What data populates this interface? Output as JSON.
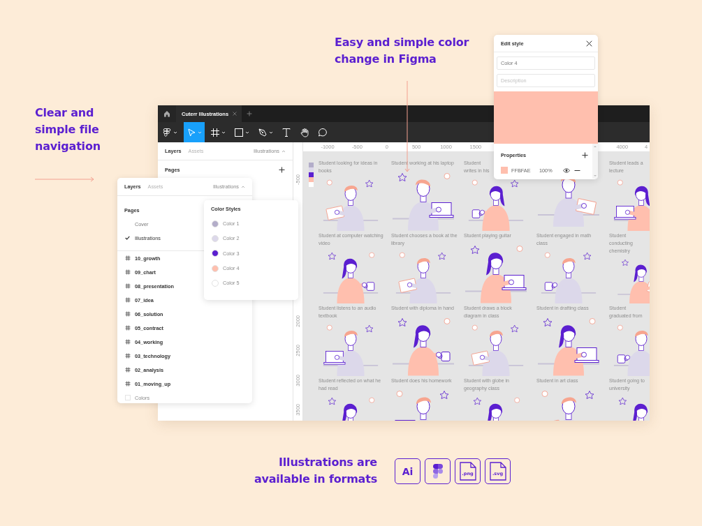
{
  "navigation_caption": "Clear and simple file navigation",
  "color_caption": "Easy and simple color change in Figma",
  "formats_caption": "Illustrations are available in formats",
  "formats": [
    {
      "kind": "ai",
      "label": "Ai"
    },
    {
      "kind": "figma"
    },
    {
      "kind": "file",
      "label": ".png"
    },
    {
      "kind": "file",
      "label": ".svg"
    }
  ],
  "window": {
    "tabs": [
      {
        "title": "Cuterr Illustrations",
        "selected": true
      }
    ],
    "tools": [
      {
        "kind": "menu",
        "selected": false,
        "dropdown": true
      },
      {
        "kind": "move",
        "selected": true,
        "dropdown": true
      },
      {
        "kind": "frame",
        "selected": false,
        "dropdown": true
      },
      {
        "kind": "rectangle",
        "selected": false,
        "dropdown": true
      },
      {
        "kind": "pen",
        "selected": false,
        "dropdown": true
      },
      {
        "kind": "text",
        "selected": false,
        "dropdown": false
      },
      {
        "kind": "hand",
        "selected": false,
        "dropdown": false
      },
      {
        "kind": "comment",
        "selected": false,
        "dropdown": false
      }
    ],
    "layers_panel": {
      "tabs": [
        {
          "label": "Layers",
          "selected": true
        },
        {
          "label": "Assets",
          "selected": false
        }
      ],
      "page_menu": "Illustrations",
      "pages_heading": "Pages"
    },
    "top_ruler": {
      "left_labels": [
        "-1000",
        "-500",
        "0",
        "500",
        "1000",
        "1500"
      ],
      "right_labels": [
        "4000",
        "4"
      ]
    },
    "left_ruler": {
      "upper_labels": [
        "-500"
      ],
      "lower_labels": [
        "2000",
        "2500",
        "3000",
        "3500"
      ]
    },
    "canvas": {
      "cells": [
        {
          "kind": "illustration",
          "caption": "Student looking for ideas in books"
        },
        {
          "kind": "illustration",
          "caption": "Student working at his laptop"
        },
        {
          "kind": "illustration",
          "caption": "Student writes in his"
        },
        {
          "kind": "illustration"
        },
        {
          "kind": "illustration",
          "caption": "Student leads a lecture"
        },
        {
          "kind": "illustration",
          "caption": "Student at computer watching video"
        },
        {
          "kind": "illustration",
          "caption": "Student chooses a book at the library"
        },
        {
          "kind": "illustration",
          "caption": "Student playing guitar"
        },
        {
          "kind": "illustration",
          "caption": "Student engaged in math class"
        },
        {
          "kind": "illustration",
          "caption": "Student conducting chemistry"
        },
        {
          "kind": "illustration",
          "caption": "Student listens to an audio textbook"
        },
        {
          "kind": "illustration",
          "caption": "Student with diploma in hand"
        },
        {
          "kind": "illustration",
          "caption": "Student draws a block diagram in class"
        },
        {
          "kind": "illustration",
          "caption": "Student in drafting class"
        },
        {
          "kind": "illustration",
          "caption": "Student graduated from"
        },
        {
          "kind": "illustration",
          "caption": "Student reflected on what he had read"
        },
        {
          "kind": "illustration",
          "caption": "Student does his homework"
        },
        {
          "kind": "illustration",
          "caption": "Student with globe in geography class"
        },
        {
          "kind": "illustration",
          "caption": "Student in art class"
        },
        {
          "kind": "illustration",
          "caption": "Student going to university"
        }
      ]
    }
  },
  "floating_layers_panel": {
    "tabs": [
      {
        "label": "Layers",
        "selected": true
      },
      {
        "label": "Assets",
        "selected": false
      }
    ],
    "page_menu": "Illustrations",
    "pages_heading": "Pages",
    "pages": [
      {
        "name": "Cover",
        "selected": false
      },
      {
        "name": "Illustrations",
        "selected": true
      }
    ],
    "layers": [
      {
        "kind": "frame",
        "name": "10_growth"
      },
      {
        "kind": "frame",
        "name": "09_chart"
      },
      {
        "kind": "frame",
        "name": "08_presentation"
      },
      {
        "kind": "frame",
        "name": "07_idea"
      },
      {
        "kind": "frame",
        "name": "06_solution"
      },
      {
        "kind": "frame",
        "name": "05_contract"
      },
      {
        "kind": "frame",
        "name": "04_working"
      },
      {
        "kind": "frame",
        "name": "03_technology"
      },
      {
        "kind": "frame",
        "name": "02_analysis"
      },
      {
        "kind": "frame",
        "name": "01_moving_up"
      },
      {
        "kind": "group",
        "name": "Colors"
      }
    ]
  },
  "color_styles": {
    "title": "Color Styles",
    "items": [
      {
        "name": "Color 1",
        "color": "#b3adc9"
      },
      {
        "name": "Color 2",
        "color": "#dcd8ea"
      },
      {
        "name": "Color 3",
        "color": "#5b1fd0"
      },
      {
        "name": "Color 4",
        "color": "#ffbfae"
      },
      {
        "name": "Color 5",
        "color": "#ffffff"
      }
    ]
  },
  "edit_style": {
    "title": "Edit style",
    "name_value": "Color 4",
    "description_placeholder": "Description",
    "color": "#ffbfae",
    "properties_heading": "Properties",
    "fill": {
      "hex": "FFBFAE",
      "opacity": "100%"
    }
  }
}
